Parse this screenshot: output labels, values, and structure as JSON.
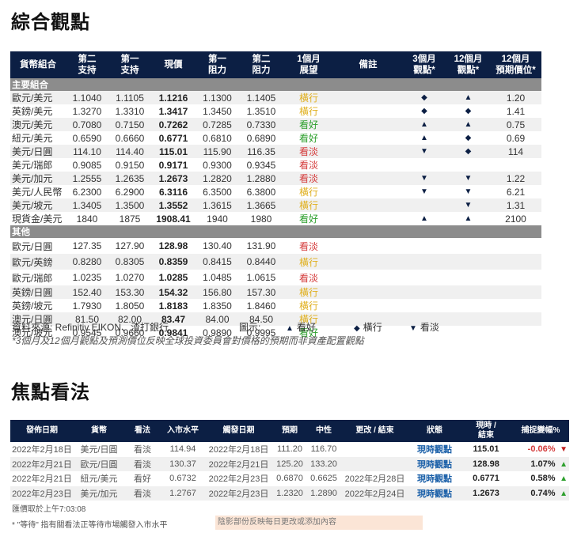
{
  "title1": "綜合觀點",
  "title2": "焦點看法",
  "table1": {
    "headers": [
      "貨幣組合",
      "第二\n支持",
      "第一\n支持",
      "現價",
      "第一\n阻力",
      "第二\n阻力",
      "1個月\n展望",
      "備註",
      "3個月\n觀點*",
      "12個月\n觀點*",
      "12個月\n預期價位*"
    ],
    "sections": [
      {
        "label": "主要組合",
        "rows": [
          {
            "pair": "歐元/美元",
            "s2": "1.1040",
            "s1": "1.1105",
            "spot": "1.1216",
            "r1": "1.1300",
            "r2": "1.1405",
            "outlook": "橫行",
            "tone": "flat",
            "note": "",
            "v3": "◆",
            "v12": "▲",
            "target": "1.20"
          },
          {
            "pair": "英鎊/美元",
            "s2": "1.3270",
            "s1": "1.3310",
            "spot": "1.3417",
            "r1": "1.3450",
            "r2": "1.3510",
            "outlook": "橫行",
            "tone": "flat",
            "note": "",
            "v3": "◆",
            "v12": "◆",
            "target": "1.41"
          },
          {
            "pair": "澳元/美元",
            "s2": "0.7080",
            "s1": "0.7150",
            "spot": "0.7262",
            "r1": "0.7285",
            "r2": "0.7330",
            "outlook": "看好",
            "tone": "up",
            "note": "",
            "v3": "▲",
            "v12": "▲",
            "target": "0.75"
          },
          {
            "pair": "紐元/美元",
            "s2": "0.6590",
            "s1": "0.6660",
            "spot": "0.6771",
            "r1": "0.6810",
            "r2": "0.6890",
            "outlook": "看好",
            "tone": "up",
            "note": "",
            "v3": "▲",
            "v12": "◆",
            "target": "0.69"
          },
          {
            "pair": "美元/日圓",
            "s2": "114.10",
            "s1": "114.40",
            "spot": "115.01",
            "r1": "115.90",
            "r2": "116.35",
            "outlook": "看淡",
            "tone": "down",
            "note": "",
            "v3": "▼",
            "v12": "◆",
            "target": "114"
          },
          {
            "pair": "美元/瑞郎",
            "s2": "0.9085",
            "s1": "0.9150",
            "spot": "0.9171",
            "r1": "0.9300",
            "r2": "0.9345",
            "outlook": "看淡",
            "tone": "down",
            "note": "",
            "v3": "",
            "v12": "",
            "target": ""
          },
          {
            "pair": "美元/加元",
            "s2": "1.2555",
            "s1": "1.2635",
            "spot": "1.2673",
            "r1": "1.2820",
            "r2": "1.2880",
            "outlook": "看淡",
            "tone": "down",
            "note": "",
            "v3": "▼",
            "v12": "▼",
            "target": "1.22"
          },
          {
            "pair": "美元/人民幣",
            "s2": "6.2300",
            "s1": "6.2900",
            "spot": "6.3116",
            "r1": "6.3500",
            "r2": "6.3800",
            "outlook": "橫行",
            "tone": "flat",
            "note": "",
            "v3": "▼",
            "v12": "▼",
            "target": "6.21"
          },
          {
            "pair": "美元/坡元",
            "s2": "1.3405",
            "s1": "1.3500",
            "spot": "1.3552",
            "r1": "1.3615",
            "r2": "1.3665",
            "outlook": "橫行",
            "tone": "flat",
            "note": "",
            "v3": "",
            "v12": "▼",
            "target": "1.31"
          },
          {
            "pair": "現貨金/美元",
            "s2": "1840",
            "s1": "1875",
            "spot": "1908.41",
            "r1": "1940",
            "r2": "1980",
            "outlook": "看好",
            "tone": "up",
            "note": "",
            "v3": "▲",
            "v12": "▲",
            "target": "2100"
          }
        ]
      },
      {
        "label": "其他",
        "rows": [
          {
            "pair": "歐元/日圓",
            "s2": "127.35",
            "s1": "127.90",
            "spot": "128.98",
            "r1": "130.40",
            "r2": "131.90",
            "outlook": "看淡",
            "tone": "down",
            "tall": true
          },
          {
            "pair": "歐元/英鎊",
            "s2": "0.8280",
            "s1": "0.8305",
            "spot": "0.8359",
            "r1": "0.8415",
            "r2": "0.8440",
            "outlook": "橫行",
            "tone": "flat",
            "tall": true
          },
          {
            "pair": "歐元/瑞郎",
            "s2": "1.0235",
            "s1": "1.0270",
            "spot": "1.0285",
            "r1": "1.0485",
            "r2": "1.0615",
            "outlook": "看淡",
            "tone": "down",
            "tall": true
          },
          {
            "pair": "英鎊/日圓",
            "s2": "152.40",
            "s1": "153.30",
            "spot": "154.32",
            "r1": "156.80",
            "r2": "157.30",
            "outlook": "橫行",
            "tone": "flat"
          },
          {
            "pair": "英鎊/坡元",
            "s2": "1.7930",
            "s1": "1.8050",
            "spot": "1.8183",
            "r1": "1.8350",
            "r2": "1.8460",
            "outlook": "橫行",
            "tone": "flat"
          },
          {
            "pair": "澳元/日圓",
            "s2": "81.50",
            "s1": "82.00",
            "spot": "83.47",
            "r1": "84.00",
            "r2": "84.50",
            "outlook": "橫行",
            "tone": "flat"
          },
          {
            "pair": "澳元/坡元",
            "s2": "0.9545",
            "s1": "0.9660",
            "spot": "0.9841",
            "r1": "0.9890",
            "r2": "0.9995",
            "outlook": "看好",
            "tone": "up"
          }
        ]
      }
    ]
  },
  "source": "資料來源: Refinitiv EIKON、渣打銀行",
  "legend": {
    "label": "圖示:",
    "up_sym": "▲",
    "up": "看好",
    "flat_sym": "◆",
    "flat": "橫行",
    "down_sym": "▼",
    "down": "看淡"
  },
  "footnote": "*3個月及12個月觀點及預測價位反映全球投資委員會對價格的預期而非資產配置觀點",
  "table2": {
    "headers": [
      "發佈日期",
      "貨幣",
      "看法",
      "入市水平",
      "觸發日期",
      "預期",
      "中性",
      "更改 / 結束",
      "狀態",
      "現時 /\n結束",
      "捕捉變幅%"
    ],
    "rows": [
      {
        "date": "2022年2月18日",
        "pair": "美元/日圓",
        "view": "看淡",
        "tone": "down",
        "entry": "114.94",
        "trigger": "2022年2月18日",
        "target": "111.20",
        "neutral": "116.70",
        "change": "",
        "status": "現時觀點",
        "current": "115.01",
        "pct": "-0.06%",
        "dir": "down"
      },
      {
        "date": "2022年2月21日",
        "pair": "歐元/日圓",
        "view": "看淡",
        "tone": "down",
        "entry": "130.37",
        "trigger": "2022年2月21日",
        "target": "125.20",
        "neutral": "133.20",
        "change": "",
        "status": "現時觀點",
        "current": "128.98",
        "pct": "1.07%",
        "dir": "up"
      },
      {
        "date": "2022年2月21日",
        "pair": "紐元/美元",
        "view": "看好",
        "tone": "up",
        "entry": "0.6732",
        "trigger": "2022年2月23日",
        "target": "0.6870",
        "neutral": "0.6625",
        "change": "2022年2月28日",
        "status": "現時觀點",
        "current": "0.6771",
        "pct": "0.58%",
        "dir": "up"
      },
      {
        "date": "2022年2月23日",
        "pair": "美元/加元",
        "view": "看淡",
        "tone": "down",
        "entry": "1.2767",
        "trigger": "2022年2月23日",
        "target": "1.2320",
        "neutral": "1.2890",
        "change": "2022年2月24日",
        "status": "現時觀點",
        "current": "1.2673",
        "pct": "0.74%",
        "dir": "up"
      }
    ]
  },
  "quote_time": "匯價取於上午7:03:08",
  "pending_note": "* \"等待\" 指有關看法正等待市場觸發入市水平",
  "shaded_note": "陰影部份反映每日更改或添加內容",
  "colors": {
    "header_bg": "#0c1f44",
    "section_bg": "#8c8c8c",
    "bullish": "#2ea02e",
    "bearish": "#d43b3b",
    "neutral": "#e0b020",
    "status": "#1a5fa8",
    "shade": "#fbe5d6"
  }
}
